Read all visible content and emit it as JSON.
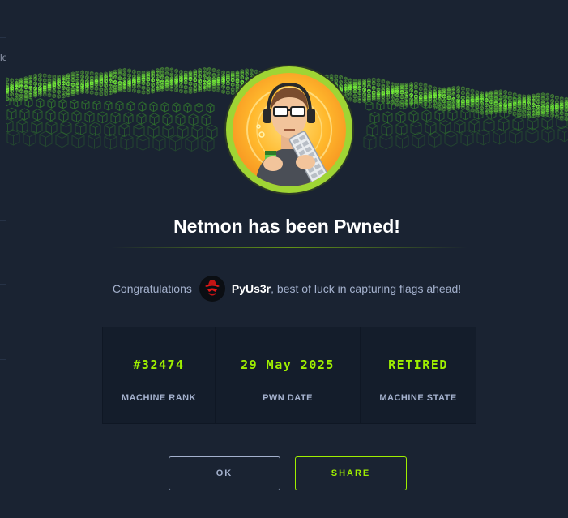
{
  "background": {
    "left_text": "le"
  },
  "modal": {
    "title": "Netmon has been Pwned!",
    "congrats_prefix": "Congratulations",
    "username": "PyUs3r",
    "congrats_suffix": ", best of luck in capturing flags ahead!",
    "stats": [
      {
        "value": "#32474",
        "label": "MACHINE RANK"
      },
      {
        "value": "29 May 2025",
        "label": "PWN DATE"
      },
      {
        "value": "RETIRED",
        "label": "MACHINE STATE"
      }
    ],
    "buttons": {
      "ok_label": "OK",
      "share_label": "SHARE"
    }
  },
  "colors": {
    "background": "#1a2332",
    "accent": "#9fef00",
    "text_muted": "#a4b1cd",
    "avatar_ring": "#9fd534"
  },
  "icons": {
    "banner": "green-cube-wave",
    "machine_avatar": "hacker-with-keyboard",
    "user_avatar": "red-hat-hacker-icon"
  }
}
